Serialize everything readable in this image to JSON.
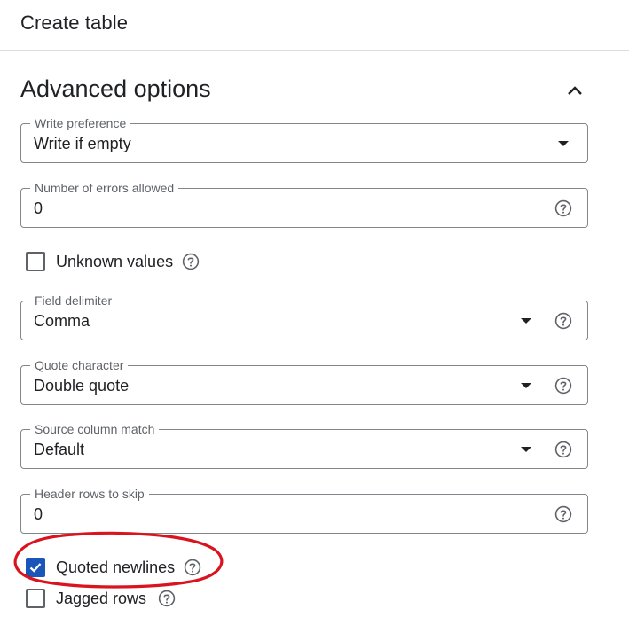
{
  "header": {
    "title": "Create table"
  },
  "section": {
    "title": "Advanced options"
  },
  "fields": {
    "write_preference": {
      "label": "Write preference",
      "value": "Write if empty"
    },
    "errors_allowed": {
      "label": "Number of errors allowed",
      "value": "0"
    },
    "field_delimiter": {
      "label": "Field delimiter",
      "value": "Comma"
    },
    "quote_character": {
      "label": "Quote character",
      "value": "Double quote"
    },
    "source_column_match": {
      "label": "Source column match",
      "value": "Default"
    },
    "header_rows_to_skip": {
      "label": "Header rows to skip",
      "value": "0"
    }
  },
  "checkboxes": {
    "unknown_values": {
      "label": "Unknown values",
      "checked": false
    },
    "quoted_newlines": {
      "label": "Quoted newlines",
      "checked": true
    },
    "jagged_rows": {
      "label": "Jagged rows",
      "checked": false
    }
  },
  "icons": {
    "collapse": "chevron-up-icon",
    "help": "help-circle-icon",
    "dropdown": "dropdown-arrow-icon",
    "check": "check-icon"
  },
  "colors": {
    "accent": "#1a56b9",
    "annotation": "#d9141f",
    "border": "#80868b"
  }
}
